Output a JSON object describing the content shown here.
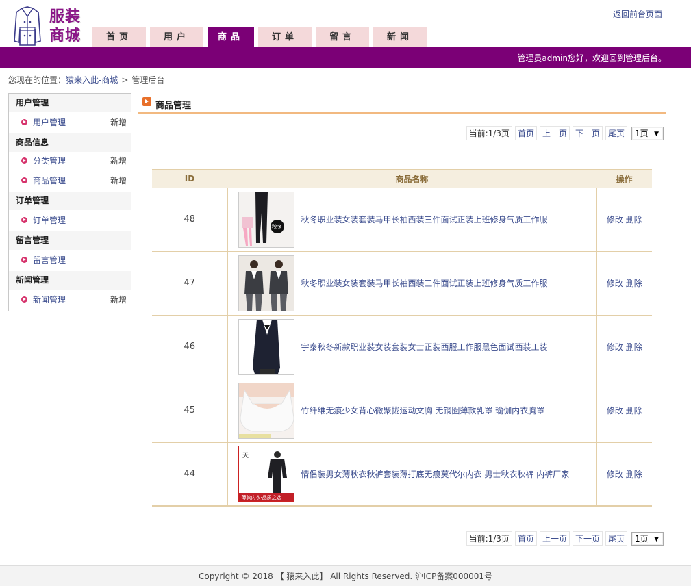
{
  "header": {
    "logo_line1": "服装",
    "logo_line2": "商城",
    "top_link": "返回前台页面",
    "welcome": "管理员admin您好，欢迎回到管理后台。"
  },
  "nav": [
    {
      "label": "首页",
      "active": false
    },
    {
      "label": "用户",
      "active": false
    },
    {
      "label": "商品",
      "active": true
    },
    {
      "label": "订单",
      "active": false
    },
    {
      "label": "留言",
      "active": false
    },
    {
      "label": "新闻",
      "active": false
    }
  ],
  "breadcrumb": {
    "prefix": "您现在的位置：",
    "home": "猿来入此-商城",
    "sep": ">",
    "current": "管理后台"
  },
  "sidebar": {
    "groups": [
      {
        "title": "用户管理",
        "items": [
          {
            "label": "用户管理",
            "add": "新增"
          }
        ]
      },
      {
        "title": "商品信息",
        "items": [
          {
            "label": "分类管理",
            "add": "新增"
          },
          {
            "label": "商品管理",
            "add": "新增"
          }
        ]
      },
      {
        "title": "订单管理",
        "items": [
          {
            "label": "订单管理",
            "add": ""
          }
        ]
      },
      {
        "title": "留言管理",
        "items": [
          {
            "label": "留言管理",
            "add": ""
          }
        ]
      },
      {
        "title": "新闻管理",
        "items": [
          {
            "label": "新闻管理",
            "add": "新增"
          }
        ]
      }
    ]
  },
  "main": {
    "title": "商品管理"
  },
  "pager": {
    "current": "当前:1/3页",
    "first": "首页",
    "prev": "上一页",
    "next": "下一页",
    "last": "尾页",
    "select": "1页"
  },
  "table": {
    "headers": {
      "id": "ID",
      "name": "商品名称",
      "op": "操作"
    },
    "edit": "修改",
    "delete": "删除",
    "rows": [
      {
        "id": "48",
        "name": "秋冬职业装女装套装马甲长袖西装三件面试正装上班修身气质工作服",
        "badge": "秋冬"
      },
      {
        "id": "47",
        "name": "秋冬职业装女装套装马甲长袖西装三件面试正装上班修身气质工作服"
      },
      {
        "id": "46",
        "name": "宇泰秋冬新款职业装女装套装女士正装西服工作服黑色面试西装工装"
      },
      {
        "id": "45",
        "name": "竹纤维无痕少女背心微聚拢运动文胸 无钢圈薄款乳罩 瑜伽内衣胸罩"
      },
      {
        "id": "44",
        "name": "情侣装男女薄秋衣秋裤套装薄打底无痕莫代尔内衣 男士秋衣秋裤 内裤厂家",
        "banner": "薄款内衣·品质之选"
      }
    ]
  },
  "footer": {
    "text": "Copyright © 2018 【 猿来入此】 All Rights Reserved. 沪ICP备案000001号"
  }
}
